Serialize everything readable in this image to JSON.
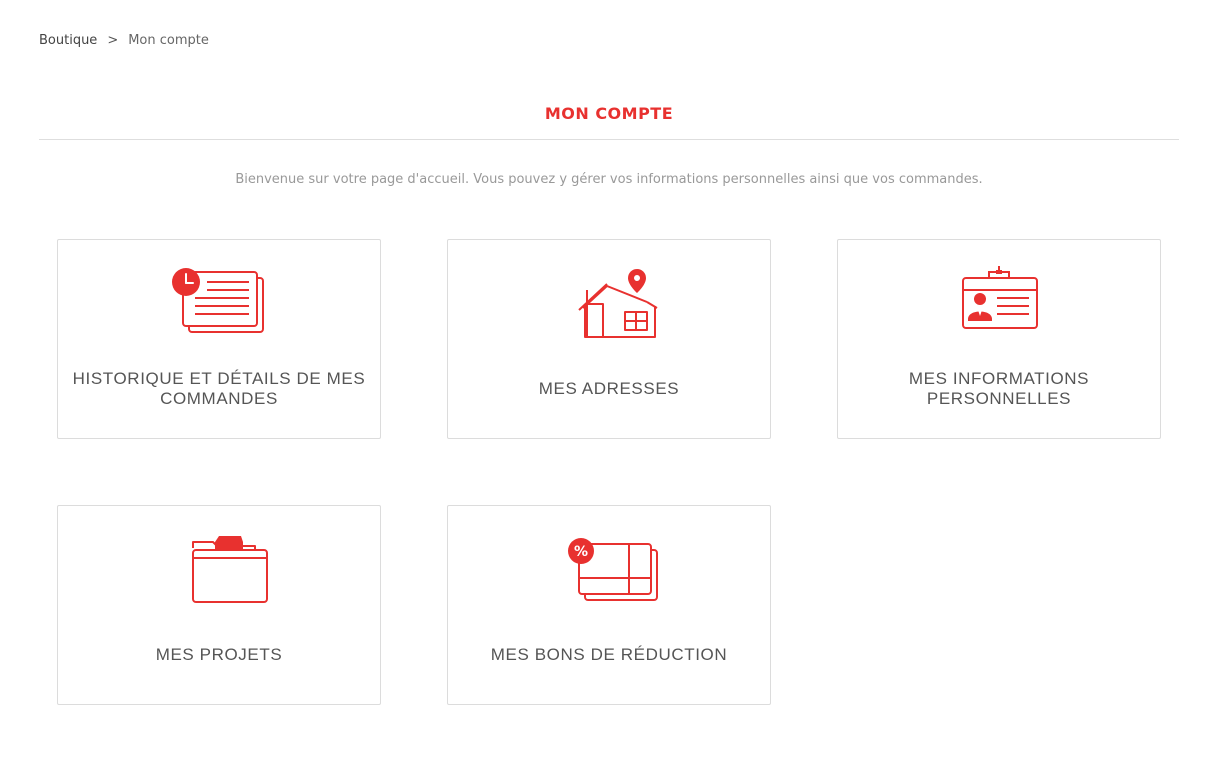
{
  "breadcrumb": {
    "home": "Boutique",
    "separator": ">",
    "current": "Mon compte"
  },
  "page": {
    "title": "MON COMPTE",
    "intro": "Bienvenue sur votre page d'accueil. Vous pouvez y gérer vos informations personnelles ainsi que vos commandes."
  },
  "cards": [
    {
      "label": "HISTORIQUE ET DÉTAILS DE MES COMMANDES",
      "icon": "order-history-icon"
    },
    {
      "label": "MES ADRESSES",
      "icon": "address-house-icon"
    },
    {
      "label": "MES INFORMATIONS PERSONNELLES",
      "icon": "id-badge-icon"
    },
    {
      "label": "MES PROJETS",
      "icon": "folder-icon"
    },
    {
      "label": "MES BONS DE RÉDUCTION",
      "icon": "voucher-icon"
    }
  ],
  "colors": {
    "accent": "#e8312f",
    "text": "#555555",
    "muted": "#999999",
    "border": "#dcdcdc"
  }
}
